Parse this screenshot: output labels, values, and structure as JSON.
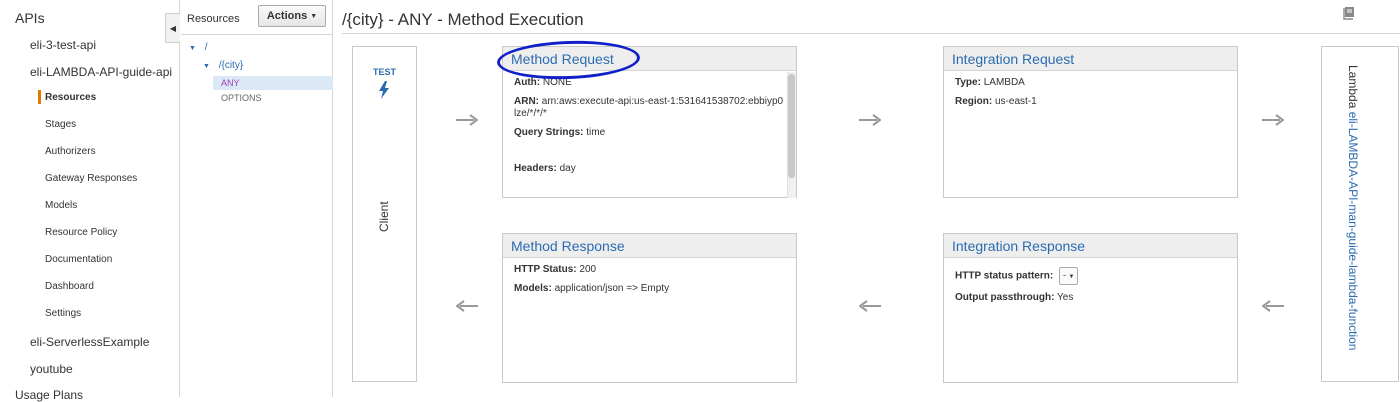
{
  "leftnav": {
    "title": "APIs",
    "apis": [
      "eli-3-test-api",
      "eli-LAMBDA-API-guide-api",
      "eli-ServerlessExample",
      "youtube"
    ],
    "sub_items": [
      "Resources",
      "Stages",
      "Authorizers",
      "Gateway Responses",
      "Models",
      "Resource Policy",
      "Documentation",
      "Dashboard",
      "Settings"
    ],
    "usage_plans": "Usage Plans"
  },
  "tree": {
    "title": "Resources",
    "actions_label": "Actions",
    "root": "/",
    "city": "/{city}",
    "methods": [
      "ANY",
      "OPTIONS"
    ]
  },
  "main": {
    "title": "/{city} - ANY - Method Execution",
    "client": {
      "test_label": "TEST",
      "label": "Client"
    },
    "method_request": {
      "title": "Method Request",
      "auth_label": "Auth:",
      "auth_value": "NONE",
      "arn_label": "ARN:",
      "arn_value": "arn:aws:execute-api:us-east-1:531641538702:ebbiyp0lze/*/*/*",
      "query_label": "Query Strings:",
      "query_value": "time",
      "headers_label": "Headers:",
      "headers_value": "day"
    },
    "integration_request": {
      "title": "Integration Request",
      "type_label": "Type:",
      "type_value": "LAMBDA",
      "region_label": "Region:",
      "region_value": "us-east-1"
    },
    "method_response": {
      "title": "Method Response",
      "status_label": "HTTP Status:",
      "status_value": "200",
      "models_label": "Models:",
      "models_value": "application/json => Empty"
    },
    "integration_response": {
      "title": "Integration Response",
      "pattern_label": "HTTP status pattern:",
      "pattern_value": "-",
      "passthrough_label": "Output passthrough:",
      "passthrough_value": "Yes"
    },
    "lambda": {
      "prefix": "Lambda",
      "function": "eli-LAMBDA-API-man-guide-lambda-function"
    }
  },
  "colors": {
    "link": "#2b6cb0",
    "accent": "#e07b00",
    "annotation": "#1020c8",
    "method_any": "#a23cb5"
  },
  "icons": [
    "chevron-left-icon",
    "caret-down-icon",
    "bolt-icon",
    "book-icon",
    "arrow-right-icon",
    "arrow-left-icon"
  ]
}
